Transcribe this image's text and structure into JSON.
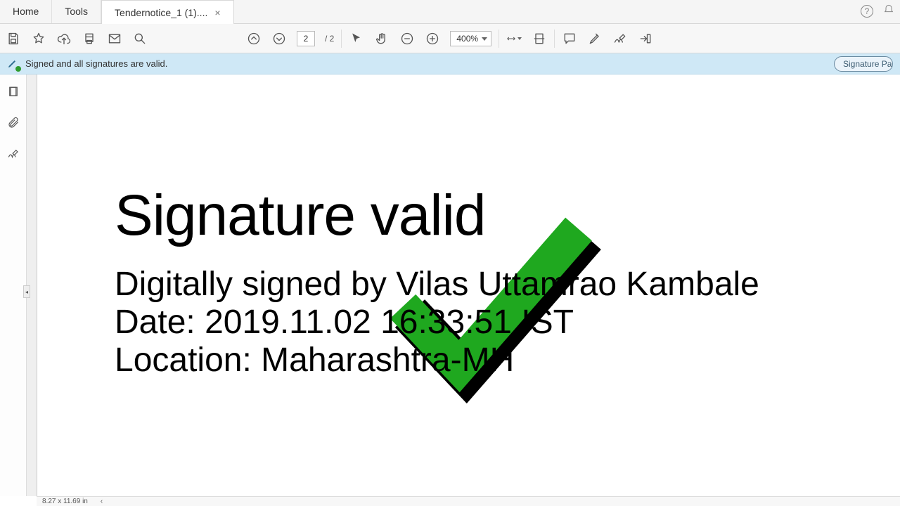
{
  "tabs": {
    "home": "Home",
    "tools": "Tools",
    "doc": "Tendernotice_1 (1)...."
  },
  "toolbar": {
    "page_current": "2",
    "page_separator": "/ 2",
    "zoom": "400%"
  },
  "banner": {
    "text": "Signed and all signatures are valid.",
    "panel_btn": "Signature Pa"
  },
  "document": {
    "title": "Signature valid",
    "line1": "Digitally signed by Vilas Uttamrao Kambale",
    "line2": "Date: 2019.11.02 16:33:51 IST",
    "line3": "Location: Maharashtra-MH"
  },
  "status": {
    "dims": "8.27 x 11.69 in",
    "arrow": "‹"
  }
}
